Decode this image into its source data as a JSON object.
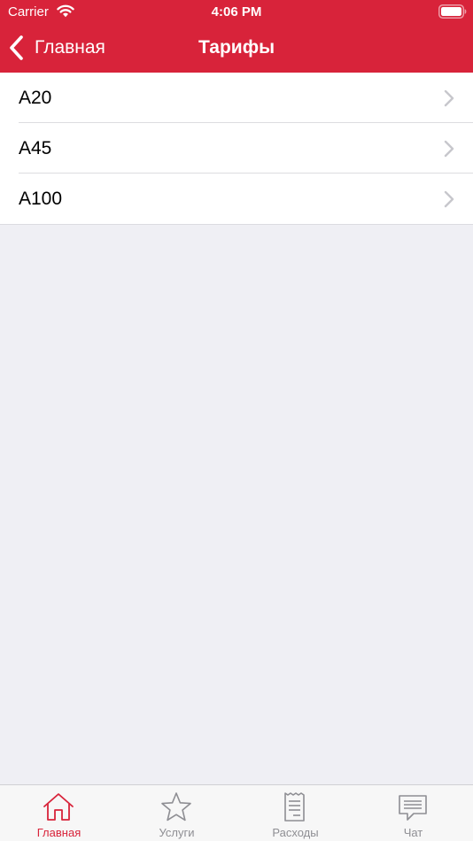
{
  "status_bar": {
    "carrier": "Carrier",
    "time": "4:06 PM",
    "wifi_icon": "wifi-icon",
    "battery_icon": "battery-icon"
  },
  "nav": {
    "back_label": "Главная",
    "title": "Тарифы",
    "background_color": "#d8233a"
  },
  "tariffs": [
    {
      "label": "A20"
    },
    {
      "label": "A45"
    },
    {
      "label": "A100"
    }
  ],
  "tab_bar": {
    "active_color": "#d8233a",
    "inactive_color": "#8e8e93",
    "tabs": [
      {
        "label": "Главная",
        "icon": "home-icon",
        "active": true
      },
      {
        "label": "Услуги",
        "icon": "star-icon",
        "active": false
      },
      {
        "label": "Расходы",
        "icon": "receipt-icon",
        "active": false
      },
      {
        "label": "Чат",
        "icon": "chat-icon",
        "active": false
      }
    ]
  }
}
